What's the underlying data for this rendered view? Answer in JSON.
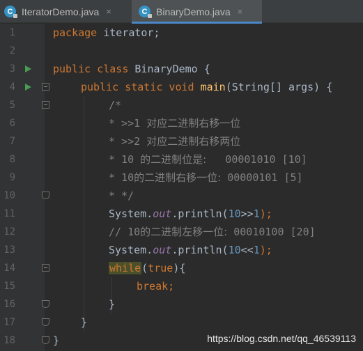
{
  "tabs": [
    {
      "label": "IteratorDemo.java",
      "icon": "java-class-icon",
      "icon_glyph": "C",
      "close": "×",
      "active": false
    },
    {
      "label": "BinaryDemo.java",
      "icon": "java-class-icon",
      "icon_glyph": "C",
      "close": "×",
      "active": true
    }
  ],
  "gutter": {
    "line_numbers": [
      "1",
      "2",
      "3",
      "4",
      "5",
      "6",
      "7",
      "8",
      "9",
      "10",
      "11",
      "12",
      "13",
      "14",
      "15",
      "16",
      "17",
      "18"
    ],
    "run_markers_on_lines": [
      3,
      4
    ]
  },
  "code": {
    "l1_kw": "package",
    "l1_rest": " iterator;",
    "l3_kw": "public class",
    "l3_rest": " BinaryDemo {",
    "l4_kw": "public static void",
    "l4_fn": "main",
    "l4_rest": "(String[] args) {",
    "l5": "/*",
    "l6_a": "* >>1 ",
    "l6_b": "对应二进制右移一位",
    "l7_a": "* >>2 ",
    "l7_b": "对应二进制右移两位",
    "l8_a": "* 10 ",
    "l8_b": "的二进制位是:",
    "l8_c": "   00001010 [10]",
    "l9_a": "* 10",
    "l9_b": "的二进制右移一位:",
    "l9_c": " 00000101 [5]",
    "l10": "* */",
    "l11_a": "System.",
    "l11_out": "out",
    "l11_b": ".println(",
    "l11_num1": "10",
    "l11_op": ">>",
    "l11_num2": "1",
    "l11_end": ");",
    "l12_a": "// 10",
    "l12_b": "的二进制左移一位:",
    "l12_c": " 00010100 [20]",
    "l13_a": "System.",
    "l13_out": "out",
    "l13_b": ".println(",
    "l13_num1": "10",
    "l13_op": "<<",
    "l13_num2": "1",
    "l13_end": ");",
    "l14_kw": "while",
    "l14_paren": "(",
    "l14_true": "true",
    "l14_end": "){",
    "l15_kw": "break",
    "l15_end": ";",
    "l16": "}",
    "l17": "}",
    "l18": "}"
  },
  "watermark": "https://blog.csdn.net/qq_46539113",
  "colors": {
    "background": "#2b2b2b",
    "gutter": "#313335",
    "keyword": "#cc7832",
    "function": "#ffc66d",
    "comment": "#808080",
    "number": "#6897bb",
    "static_field": "#9876aa",
    "run_marker": "#499c54",
    "tab_accent": "#4a88c7"
  }
}
